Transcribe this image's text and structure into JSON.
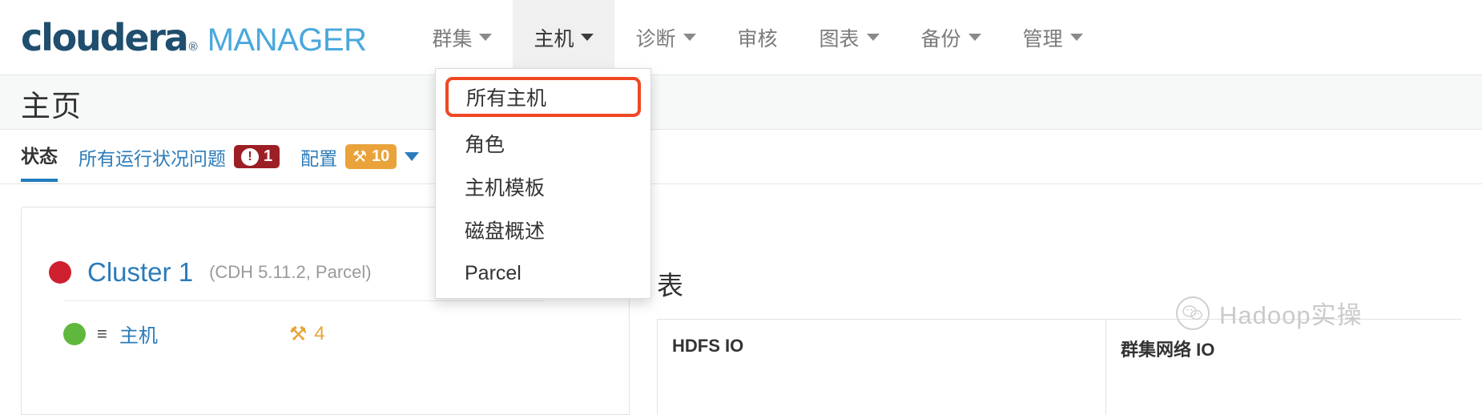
{
  "brand": {
    "name": "cloudera",
    "registered_mark": "®",
    "product": "MANAGER",
    "primary_color": "#1f4e6e",
    "accent_color": "#4aa8dd"
  },
  "nav": {
    "items": [
      {
        "label": "群集",
        "has_caret": true,
        "active": false
      },
      {
        "label": "主机",
        "has_caret": true,
        "active": true
      },
      {
        "label": "诊断",
        "has_caret": true,
        "active": false
      },
      {
        "label": "审核",
        "has_caret": false,
        "active": false
      },
      {
        "label": "图表",
        "has_caret": true,
        "active": false
      },
      {
        "label": "备份",
        "has_caret": true,
        "active": false
      },
      {
        "label": "管理",
        "has_caret": true,
        "active": false
      }
    ]
  },
  "dropdown": {
    "open_for": "主机",
    "highlight_color": "#ef4823",
    "items": [
      {
        "label": "所有主机",
        "highlighted": true
      },
      {
        "label": "角色",
        "highlighted": false
      },
      {
        "label": "主机模板",
        "highlighted": false
      },
      {
        "label": "磁盘概述",
        "highlighted": false
      },
      {
        "label": "Parcel",
        "highlighted": false
      }
    ]
  },
  "page": {
    "title": "主页"
  },
  "tabs": {
    "status_label": "状态",
    "health_issues_label": "所有运行状况问题",
    "health_issues_count": "1",
    "health_badge_color": "#9c1f25",
    "config_label": "配置",
    "config_count": "10",
    "config_badge_color": "#e9a33a",
    "bang_glyph": "!",
    "wrench_glyph": "⚒"
  },
  "cluster": {
    "status_color": "#cf2030",
    "name": "Cluster 1",
    "meta": "(CDH 5.11.2, Parcel)",
    "host": {
      "status_color": "#5fb83d",
      "list_icon": "≡",
      "label": "主机",
      "wrench_glyph": "⚒",
      "wrench_count": "4",
      "wrench_color": "#e9a33a"
    }
  },
  "charts": {
    "section_title": "表",
    "cells": [
      {
        "label": "HDFS IO"
      },
      {
        "label": "群集网络 IO"
      }
    ]
  },
  "watermark": {
    "icon": "wechat-icon",
    "text": "Hadoop实操"
  }
}
